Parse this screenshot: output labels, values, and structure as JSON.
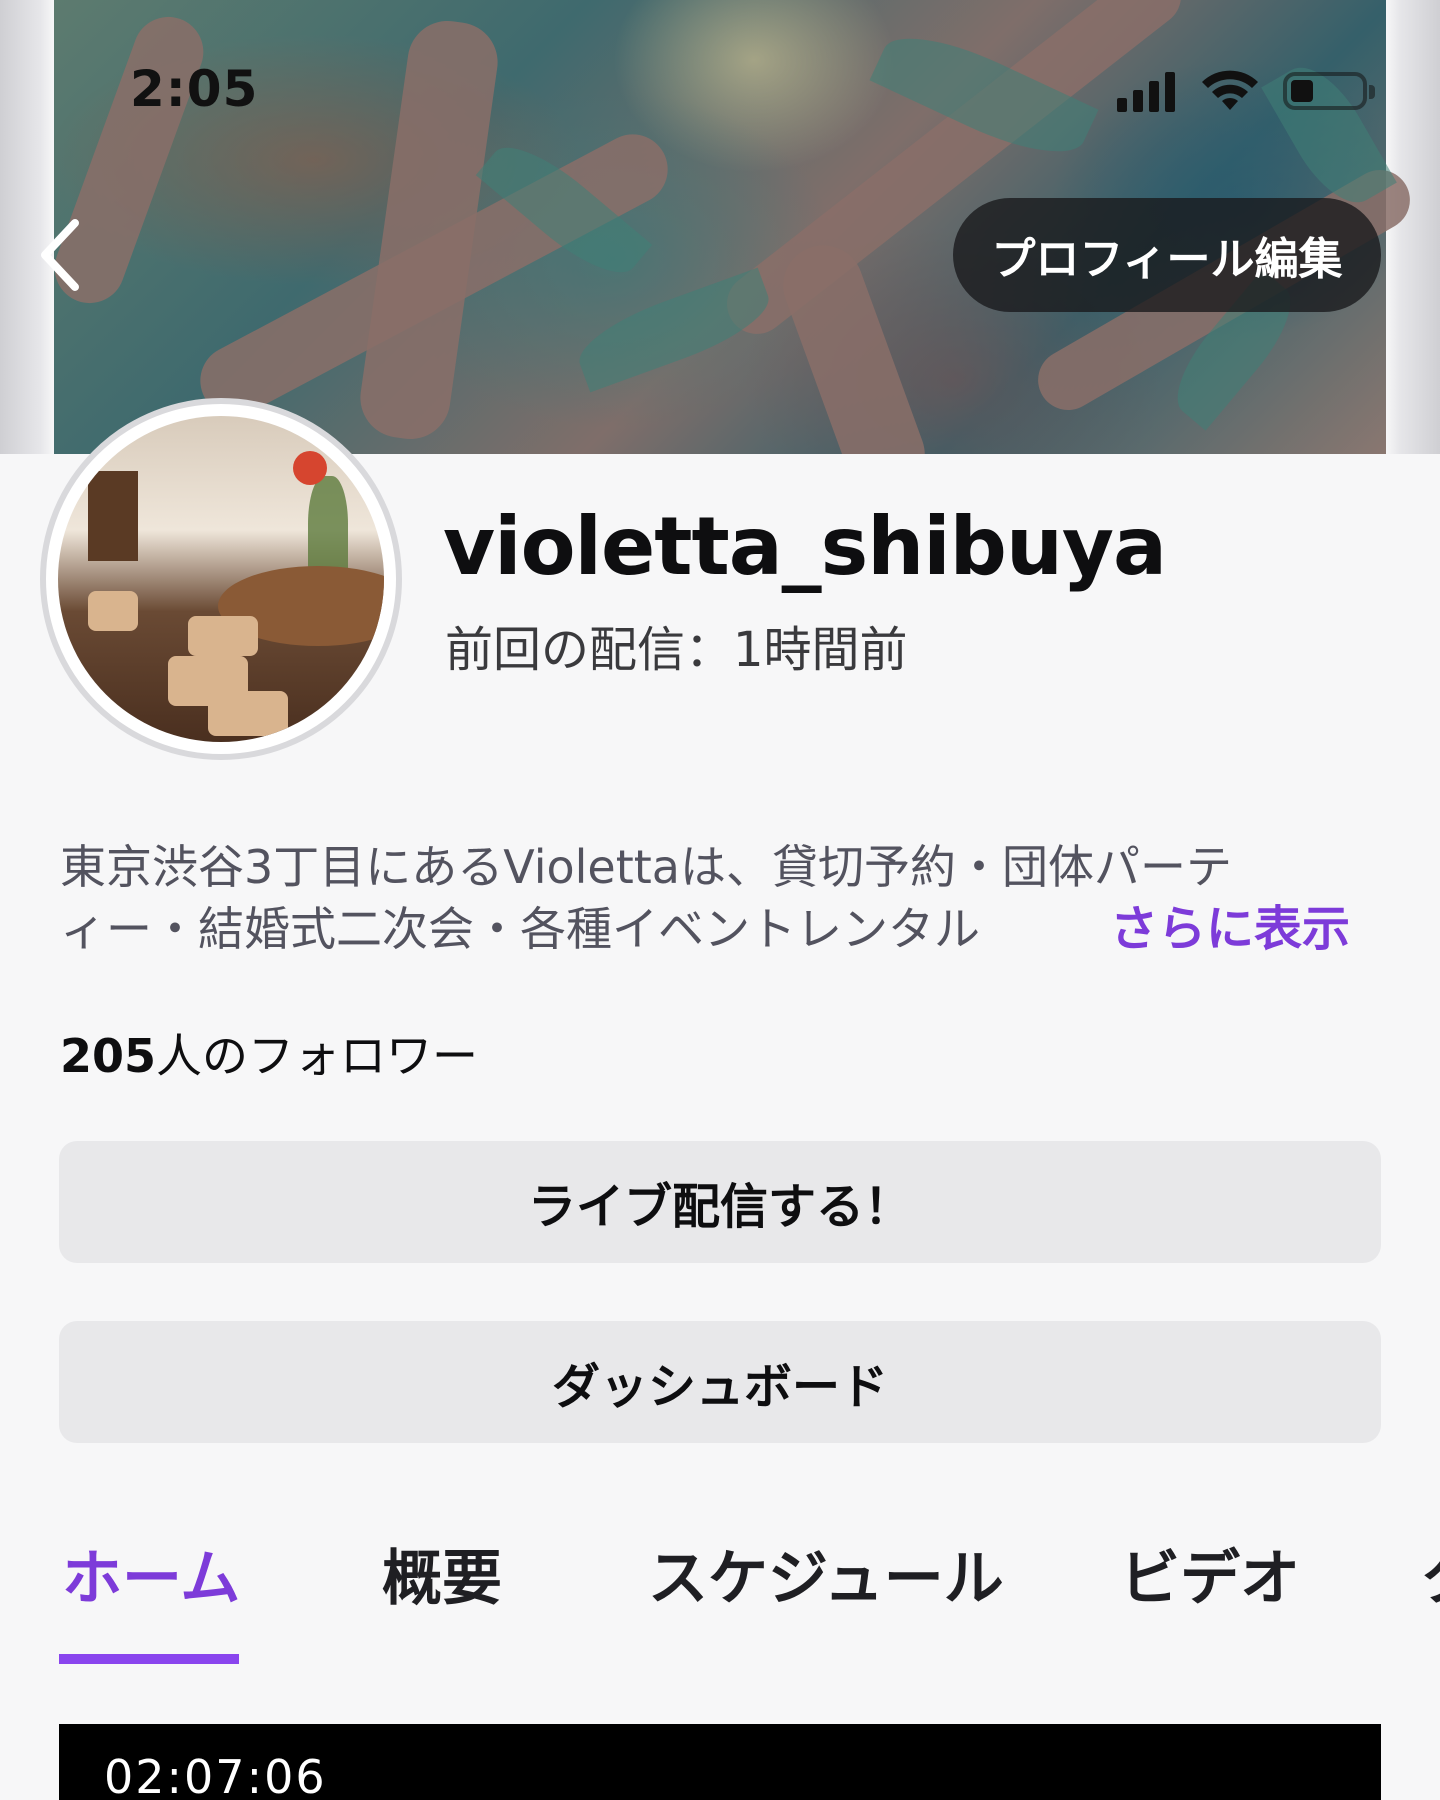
{
  "status_bar": {
    "time": "2:05"
  },
  "header": {
    "back_icon": "chevron-left-icon",
    "edit_profile_label": "プロフィール編集"
  },
  "profile": {
    "username": "violetta_shibuya",
    "last_stream": "前回の配信：1時間前",
    "bio_line1": "東京渋谷3丁目にあるViolettaは、貸切予約・団体パーテ",
    "bio_line2": "ィー・結婚式二次会・各種イベントレンタル",
    "more_label": "さらに表示",
    "followers_count": "205",
    "followers_suffix": "人のフォロワー"
  },
  "actions": {
    "go_live_label": "ライブ配信する！",
    "dashboard_label": "ダッシュボード"
  },
  "tabs": [
    {
      "label": "ホーム",
      "active": true
    },
    {
      "label": "概要",
      "active": false
    },
    {
      "label": "スケジュール",
      "active": false
    },
    {
      "label": "ビデオ",
      "active": false
    },
    {
      "label": "ク",
      "active": false
    }
  ],
  "video": {
    "timestamp": "02:07:06"
  },
  "colors": {
    "accent": "#7d3bd9",
    "background": "#f7f7f8",
    "button_bg": "#e8e8ea"
  }
}
